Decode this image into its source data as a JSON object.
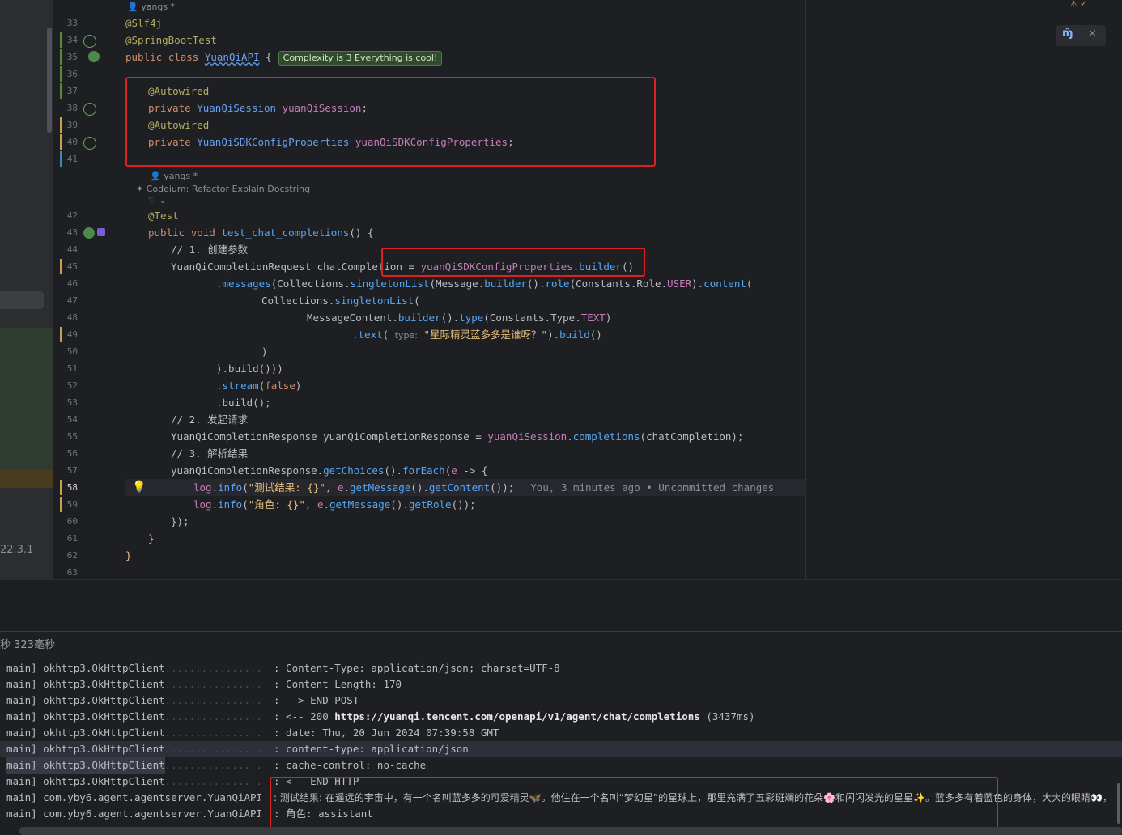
{
  "editor": {
    "author_hint_top": "yangs *",
    "author_hint_method": "yangs *",
    "codeium_prefix": "Codeium:",
    "codeium_actions": [
      "Refactor",
      "Explain",
      "Docstring"
    ],
    "codeium_more": "♡ ⌄",
    "complexity_badge": "Complexity is 3 Everything is cool!",
    "version_label": "22.3.1",
    "inline_blame": "You, 3 minutes ago • Uncommitted changes",
    "param_hint": "type:",
    "line_numbers": [
      "33",
      "34",
      "35",
      "36",
      "37",
      "38",
      "39",
      "40",
      "41",
      "42",
      "43",
      "44",
      "45",
      "46",
      "47",
      "48",
      "49",
      "50",
      "51",
      "52",
      "53",
      "54",
      "55",
      "56",
      "57",
      "58",
      "59",
      "60",
      "61",
      "62",
      "63"
    ],
    "current_line": "58",
    "tokens": {
      "slf4j": "@Slf4j",
      "springboot": "@SpringBootTest",
      "public": "public",
      "class": "class",
      "classname": "YuanQiAPI",
      "brace_open": " {",
      "autowired": "@Autowired",
      "private": "private",
      "session_type": "YuanQiSession",
      "session_var": "yuanQiSession",
      "semi": ";",
      "config_type": "YuanQiSDKConfigProperties",
      "config_var": "yuanQiSDKConfigProperties",
      "test": "@Test",
      "void": "void",
      "method": "test_chat_completions",
      "method_tail": "() {",
      "c1": "// 1. 创建参数",
      "req_type": "YuanQiCompletionRequest",
      "req_var": "chatCompletion",
      "eq": " = ",
      "builder": "builder",
      "paren": "()",
      "dot": ".",
      "messages": "messages",
      "collections": "Collections",
      "singletonList": "singletonList",
      "message": "Message",
      "role": "role",
      "constants": "Constants",
      "role_cls": "Role",
      "user": "USER",
      "content": "content",
      "open": "(",
      "close": ")",
      "closeclose": "))",
      "message_content": "MessageContent",
      "type": "type",
      "type_cls": "Type",
      "text_const": "TEXT",
      "text": "text",
      "question": "\"星际精灵蓝多多是谁呀？\"",
      "build": "build",
      "build3": ").build()))",
      "stream": "stream",
      "false": "false",
      "build_end": ".build();",
      "c2": "// 2. 发起请求",
      "resp_type": "YuanQiCompletionResponse",
      "resp_var": "yuanQiCompletionResponse",
      "completions": "completions",
      "c3": "// 3. 解析结果",
      "getChoices": "getChoices",
      "forEach": "forEach",
      "lam_e": "e",
      "arrow": " -> {",
      "log": "log",
      "info": "info",
      "fmt1": "\"测试结果: {}\"",
      "fmt2": "\"角色: {}\"",
      "comma": ", ",
      "getMessage": "getMessage",
      "getContent": "getContent",
      "getRole": "getRole",
      "end_call": "());",
      "close_lambda": "});",
      "rbrace": "}"
    }
  },
  "widget": {
    "logo": "ɱ̃",
    "close": "×"
  },
  "run": {
    "duration": "秒 323毫秒"
  },
  "console": {
    "rows": [
      {
        "src": "main] okhttp3.OkHttpClient",
        "msg": ": Content-Type: application/json; charset=UTF-8"
      },
      {
        "src": "main] okhttp3.OkHttpClient",
        "msg": ": Content-Length: 170"
      },
      {
        "src": "main] okhttp3.OkHttpClient",
        "msg": ": --> END POST"
      },
      {
        "src": "main] okhttp3.OkHttpClient",
        "msg_pre": ": <-- 200 ",
        "link": "https://yuanqi.tencent.com/openapi/v1/agent/chat/completions",
        "msg_post": " (3437ms)"
      },
      {
        "src": "main] okhttp3.OkHttpClient",
        "msg": ": date: Thu, 20 Jun 2024 07:39:58 GMT"
      },
      {
        "src": "main] okhttp3.OkHttpClient",
        "msg": ": content-type: application/json"
      },
      {
        "src": "main] okhttp3.OkHttpClient",
        "msg": ": cache-control: no-cache"
      },
      {
        "src": "main] okhttp3.OkHttpClient",
        "msg": ": <-- END HTTP"
      },
      {
        "src": "main] com.yby6.agent.agentserver.YuanQiAPI",
        "msg": ": 测试结果: 在遥远的宇宙中，有一个名叫蓝多多的可爱精灵🦋。他住在一个名叫“梦幻星”的星球上，那里充满了五彩斑斓的花朵🌸和闪闪发光的星星✨。蓝多多有着蓝色的身体，大大的眼睛👀，"
      },
      {
        "src": "main] com.yby6.agent.agentserver.YuanQiAPI",
        "msg": ": 角色: assistant"
      }
    ]
  }
}
